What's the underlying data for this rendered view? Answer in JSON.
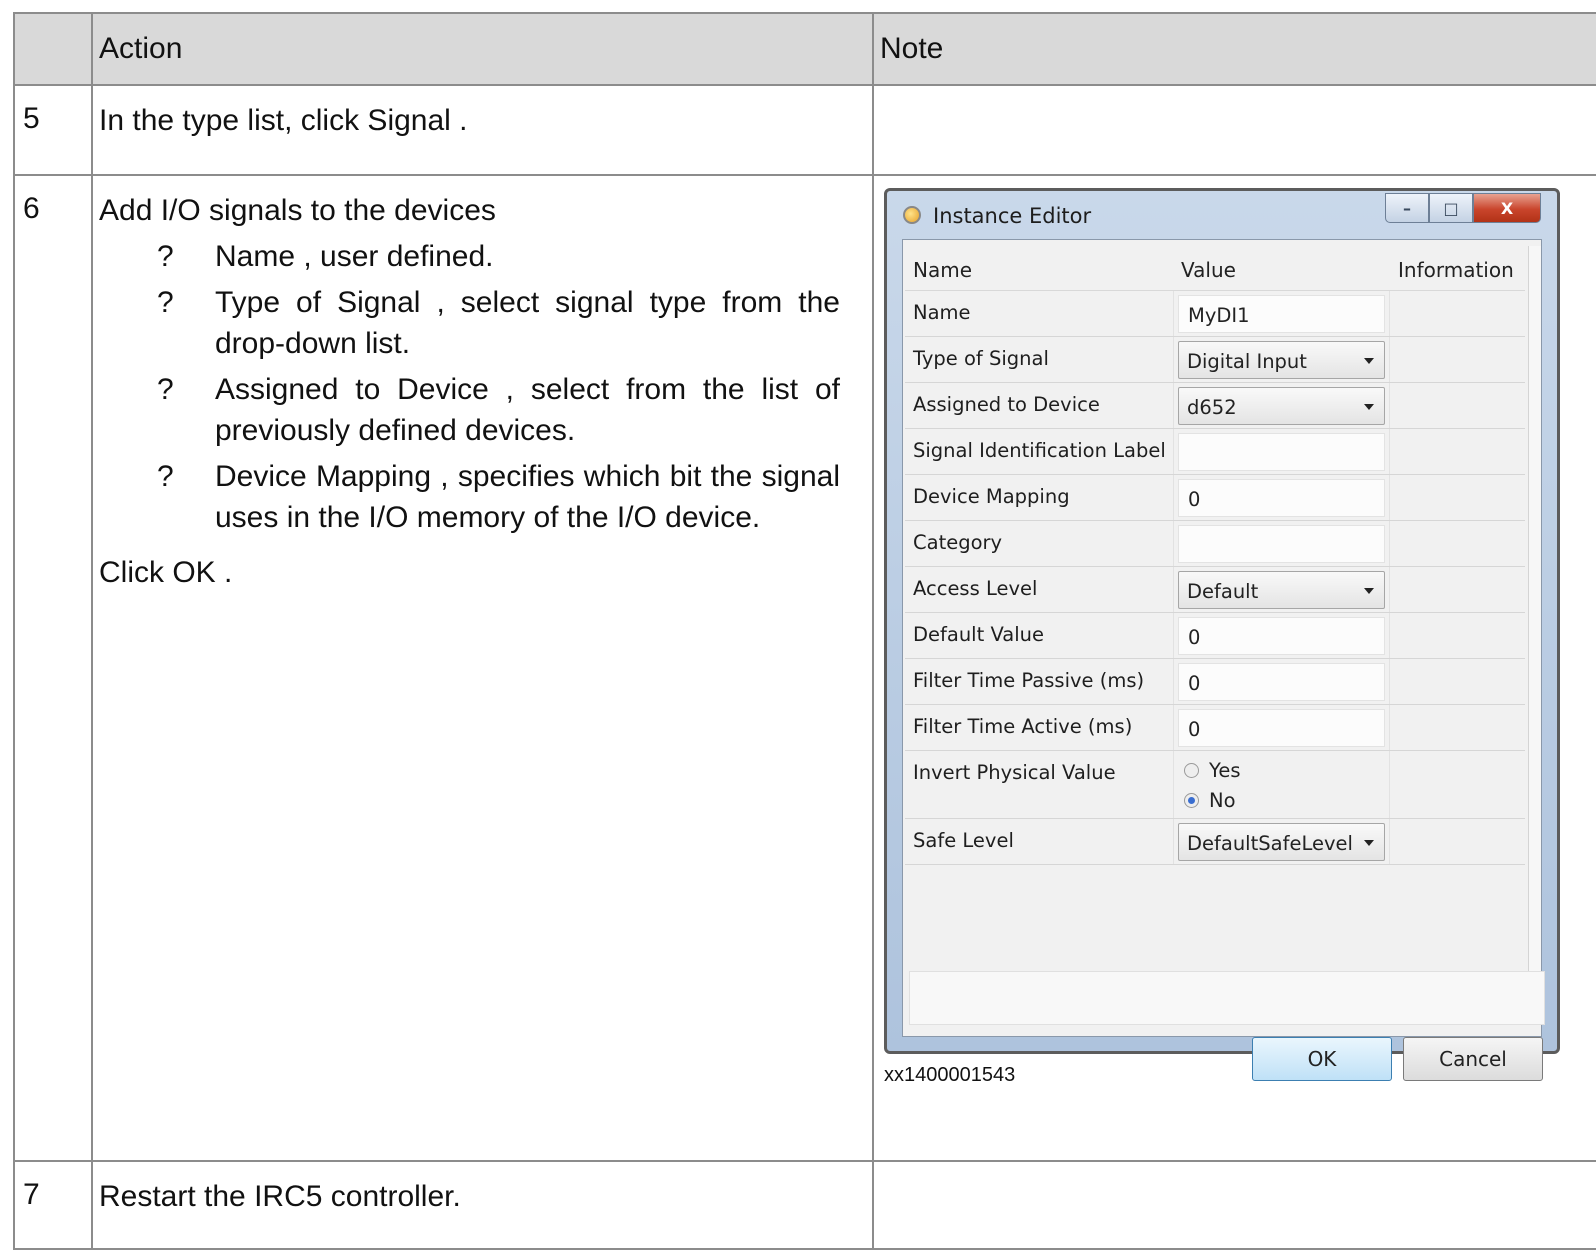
{
  "table": {
    "headers": {
      "num": "",
      "action": "Action",
      "note": "Note"
    },
    "rows": [
      {
        "num": "5",
        "action": "In the type list, click Signal ."
      },
      {
        "num": "6",
        "action_intro": "Add I/O signals to the devices",
        "bullet_char": "?",
        "bullets": [
          "Name , user defined.",
          "Type of Signal , select signal type from the drop-down list.",
          "Assigned to Device , select from the list of previously defined devices.",
          "Device Mapping , specifies which bit the signal uses in the I/O memory of the I/O device."
        ],
        "action_outro": "Click OK .",
        "figure_id": "xx1400001543"
      },
      {
        "num": "7",
        "action": "Restart the IRC5 controller."
      }
    ]
  },
  "dialog": {
    "title": "Instance Editor",
    "window_buttons": {
      "minimize": "–",
      "maximize": "□",
      "close": "X"
    },
    "columns": {
      "name": "Name",
      "value": "Value",
      "information": "Information"
    },
    "properties": [
      {
        "name": "Name",
        "kind": "text",
        "value": "MyDI1"
      },
      {
        "name": "Type of Signal",
        "kind": "combo",
        "value": "Digital Input"
      },
      {
        "name": "Assigned to Device",
        "kind": "combo",
        "value": "d652"
      },
      {
        "name": "Signal Identification Label",
        "kind": "text",
        "value": ""
      },
      {
        "name": "Device Mapping",
        "kind": "text",
        "value": "0"
      },
      {
        "name": "Category",
        "kind": "text",
        "value": ""
      },
      {
        "name": "Access Level",
        "kind": "combo",
        "value": "Default"
      },
      {
        "name": "Default Value",
        "kind": "text",
        "value": "0"
      },
      {
        "name": "Filter Time Passive (ms)",
        "kind": "text",
        "value": "0"
      },
      {
        "name": "Filter Time Active (ms)",
        "kind": "text",
        "value": "0"
      },
      {
        "name": "Invert Physical Value",
        "kind": "radio",
        "options": [
          "Yes",
          "No"
        ],
        "selected": "No"
      },
      {
        "name": "Safe Level",
        "kind": "combo",
        "value": "DefaultSafeLevel"
      }
    ],
    "ok_label": "OK",
    "cancel_label": "Cancel"
  }
}
